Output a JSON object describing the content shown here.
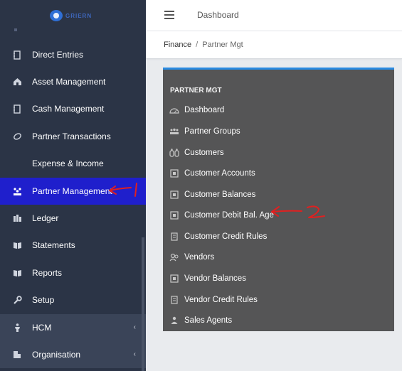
{
  "app": {
    "logo_text": "GRIERN"
  },
  "colors": {
    "sidebar_bg": "#2b3446",
    "sidebar_active": "#1f1fcc",
    "panel_bg": "#555556",
    "panel_accent": "#2a8be2",
    "annotation_red": "#e02020"
  },
  "sidebar": {
    "items": [
      {
        "label": "Direct Entries",
        "icon": "ledger-icon"
      },
      {
        "label": "Asset Management",
        "icon": "asset-icon"
      },
      {
        "label": "Cash Management",
        "icon": "cash-icon"
      },
      {
        "label": "Partner Transactions",
        "icon": "partner-transactions-icon"
      },
      {
        "label": "Expense & Income",
        "icon": "expense-icon"
      },
      {
        "label": "Partner Management",
        "icon": "partner-icon",
        "active": true
      },
      {
        "label": "Ledger",
        "icon": "ledger-book-icon"
      },
      {
        "label": "Statements",
        "icon": "statements-icon"
      },
      {
        "label": "Reports",
        "icon": "reports-icon"
      },
      {
        "label": "Setup",
        "icon": "wrench-icon"
      },
      {
        "label": "HCM",
        "icon": "person-icon",
        "expandable": true
      },
      {
        "label": "Organisation",
        "icon": "building-icon",
        "expandable": true
      }
    ]
  },
  "header": {
    "title": "Dashboard"
  },
  "breadcrumb": {
    "root": "Finance",
    "separator": "/",
    "current": "Partner Mgt"
  },
  "panel": {
    "title": "PARTNER MGT",
    "items": [
      {
        "label": "Dashboard",
        "icon": "dashboard-icon"
      },
      {
        "label": "Partner Groups",
        "icon": "group-icon"
      },
      {
        "label": "Customers",
        "icon": "customers-icon"
      },
      {
        "label": "Customer Accounts",
        "icon": "account-icon"
      },
      {
        "label": "Customer Balances",
        "icon": "account-icon"
      },
      {
        "label": "Customer Debit Bal. Age",
        "icon": "account-icon"
      },
      {
        "label": "Customer Credit Rules",
        "icon": "rules-icon"
      },
      {
        "label": "Vendors",
        "icon": "vendor-icon"
      },
      {
        "label": "Vendor Balances",
        "icon": "account-icon"
      },
      {
        "label": "Vendor Credit Rules",
        "icon": "rules-icon"
      },
      {
        "label": "Sales Agents",
        "icon": "agent-icon"
      }
    ]
  }
}
